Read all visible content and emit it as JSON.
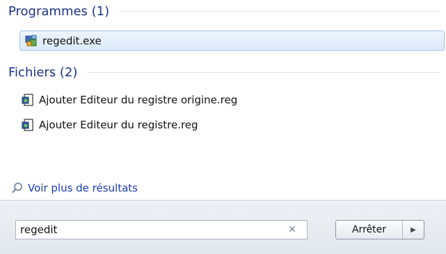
{
  "groups": {
    "programs": {
      "title": "Programmes (1)",
      "items": [
        {
          "label": "regedit.exe",
          "icon": "regedit-icon"
        }
      ]
    },
    "files": {
      "title": "Fichiers (2)",
      "items": [
        {
          "label": "Ajouter Editeur du registre origine.reg",
          "icon": "reg-file-icon"
        },
        {
          "label": "Ajouter Editeur du registre.reg",
          "icon": "reg-file-icon"
        }
      ]
    }
  },
  "more_results": {
    "label": "Voir plus de résultats",
    "icon": "search-icon"
  },
  "search": {
    "value": "regedit",
    "clear_icon": "close-icon"
  },
  "actions": {
    "stop_label": "Arrêter",
    "arrow_icon": "arrow-right-icon"
  },
  "colors": {
    "header": "#1e3287",
    "link": "#1a3bb0",
    "selection_border": "#9fc2ea"
  }
}
